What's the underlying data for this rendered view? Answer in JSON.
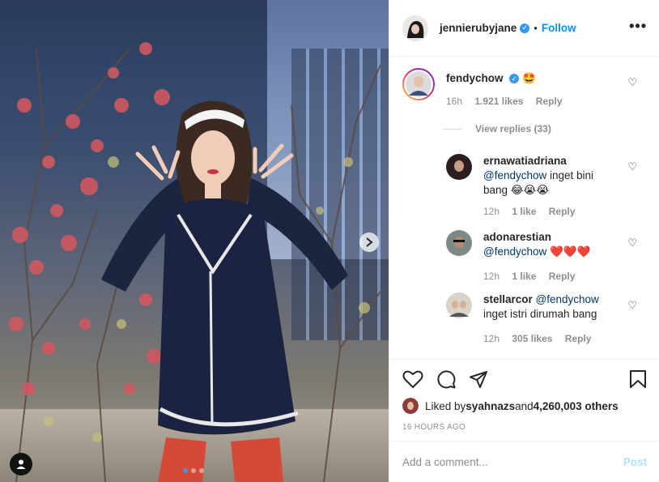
{
  "post": {
    "author": "jennierubyjane",
    "follow_label": "Follow",
    "separator": "•",
    "more_label": "•••",
    "media_dots": 3,
    "active_dot": 0
  },
  "comments": [
    {
      "user": "fendychow",
      "verified": true,
      "text": "🤩",
      "time": "16h",
      "likes": "1.921 likes",
      "reply": "Reply",
      "view_replies": "View replies (33)"
    },
    {
      "user": "ernawatiadriana",
      "mention": "@fendychow",
      "text_line1": " inget bini",
      "text_line2": "bang 😂😭😭",
      "time": "12h",
      "likes": "1 like",
      "reply": "Reply"
    },
    {
      "user": "adonarestian",
      "mention": "@fendychow",
      "text": " ❤️❤️❤️",
      "time": "12h",
      "likes": "1 like",
      "reply": "Reply"
    },
    {
      "user": "stellarcor",
      "mention": "@fendychow",
      "text": "inget istri dirumah bang",
      "time": "12h",
      "likes": "305 likes",
      "reply": "Reply"
    }
  ],
  "likes": {
    "prefix": "Liked by ",
    "user": "syahnazs",
    "middle": " and ",
    "count": "4,260,003 others"
  },
  "time_ago": "16 HOURS AGO",
  "add_comment": {
    "placeholder": "Add a comment...",
    "post_label": "Post"
  },
  "icons": {
    "like": "heart-icon",
    "comment": "comment-icon",
    "share": "share-icon",
    "save": "bookmark-icon",
    "next": "chevron-right-icon",
    "tag": "user-tag-icon",
    "more": "more-options-icon",
    "verified": "verified-badge-icon"
  },
  "colors": {
    "link": "#0095f6",
    "verified": "#3897f0",
    "muted": "#8e8e8e",
    "post_disabled": "#b2dffc",
    "text": "#262626"
  }
}
